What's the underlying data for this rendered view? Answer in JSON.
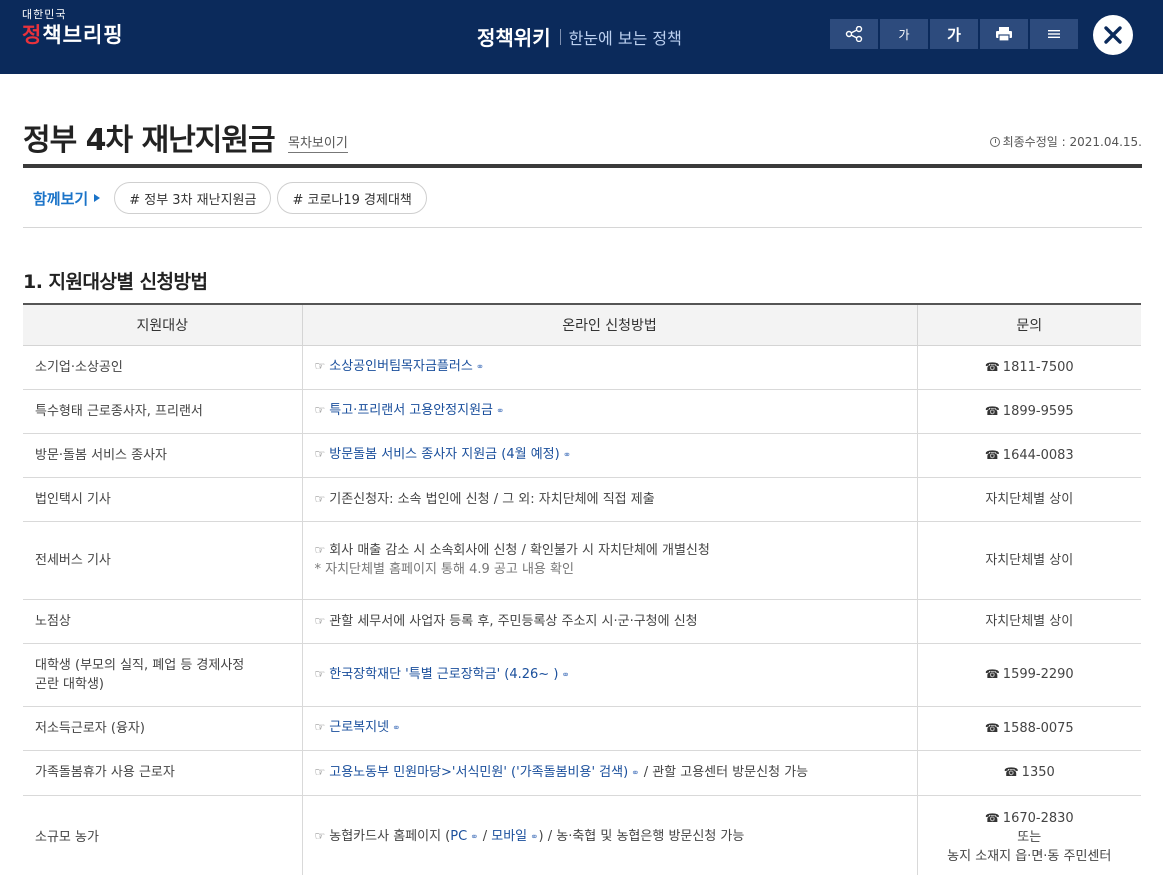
{
  "header": {
    "logo_small": "대한민국",
    "logo_big_a": "정",
    "logo_big_b": "책브리핑",
    "site_title": "정책위키",
    "site_subtitle": "한눈에 보는 정책",
    "font_small": "가",
    "font_big": "가",
    "colors": {
      "bar": "#0b2a5b",
      "button": "#2d4b7d",
      "accent_red": "#e8323c"
    },
    "icons": [
      "share-icon",
      "print-icon",
      "menu-icon",
      "close-icon"
    ]
  },
  "page": {
    "title": "정부 4차 재난지원금",
    "toc_label": "목차보이기",
    "updated": "최종수정일 : 2021.04.15."
  },
  "related": {
    "label": "함께보기",
    "tags": [
      "# 정부 3차 재난지원금",
      "# 코로나19 경제대책"
    ]
  },
  "section": {
    "title": "1. 지원대상별 신청방법"
  },
  "table": {
    "headers": [
      "지원대상",
      "온라인 신청방법",
      "문의"
    ],
    "rows": [
      {
        "target": "소기업·소상공인",
        "method_link": "소상공인버팀목자금플러스",
        "contact": "1811-7500"
      },
      {
        "target": "특수형태 근로종사자, 프리랜서",
        "method_link": "특고·프리랜서 고용안정지원금",
        "contact": "1899-9595"
      },
      {
        "target": "방문·돌봄 서비스 종사자",
        "method_link": "방문돌봄 서비스 종사자 지원금 (4월 예정)",
        "contact": "1644-0083"
      },
      {
        "target": "법인택시 기사",
        "method": "기존신청자: 소속 법인에 신청 / 그 외: 자치단체에 직접 제출",
        "contact": "자치단체별 상이"
      },
      {
        "target": "전세버스 기사",
        "method": "회사 매출 감소 시 소속회사에 신청 / 확인불가 시 자치단체에 개별신청",
        "method_note": "* 자치단체별 홈페이지 통해 4.9 공고 내용 확인",
        "contact": "자치단체별 상이"
      },
      {
        "target": "노점상",
        "method": "관할 세무서에 사업자 등록 후, 주민등록상 주소지 시·군·구청에 신청",
        "contact": "자치단체별 상이"
      },
      {
        "target_1": "대학생 (부모의 실직, 폐업 등 경제사정",
        "target_2": "곤란 대학생)",
        "method_link": "한국장학재단 '특별 근로장학금' (4.26~ )",
        "contact": "1599-2290"
      },
      {
        "target": "저소득근로자 (융자)",
        "method_link": "근로복지넷",
        "contact": "1588-0075"
      },
      {
        "target": "가족돌봄휴가 사용 근로자",
        "method_link": "고용노동부 민원마당>'서식민원' ('가족돌봄비용' 검색)",
        "method_tail": "/ 관할 고용센터 방문신청 가능",
        "contact": "1350"
      },
      {
        "target": "소규모 농가",
        "method_pre": "농협카드사 홈페이지 (",
        "method_link_a": "PC",
        "method_mid": "/",
        "method_link_b": "모바일",
        "method_tail": ") / 농·축협 및 농협은행 방문신청 가능",
        "contact": "1670-2830",
        "contact_2": "또는",
        "contact_3": "농지 소재지 읍·면·동 주민센터"
      }
    ]
  }
}
